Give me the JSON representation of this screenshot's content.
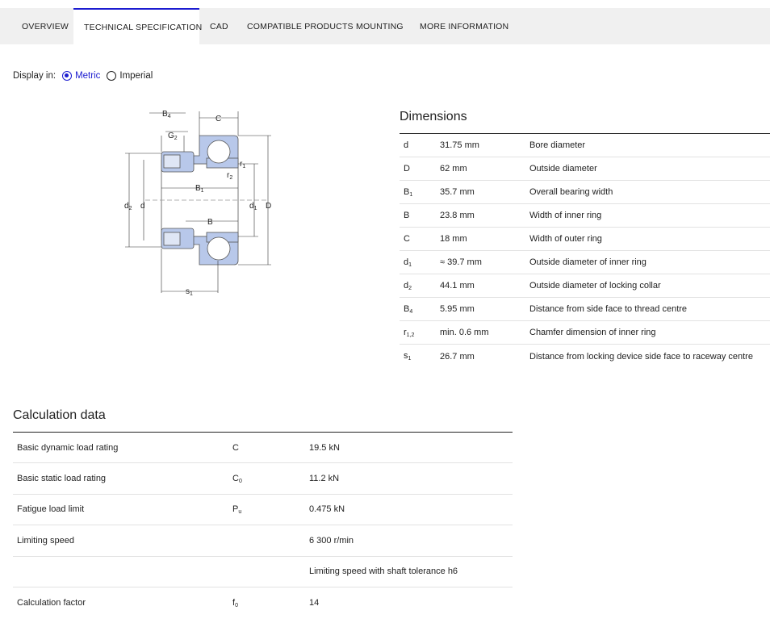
{
  "tabs": [
    {
      "label": "OVERVIEW"
    },
    {
      "label": "TECHNICAL SPECIFICATION"
    },
    {
      "label": "CAD"
    },
    {
      "label": "COMPATIBLE PRODUCTS"
    },
    {
      "label": "MOUNTING"
    },
    {
      "label": "MORE INFORMATION"
    }
  ],
  "display": {
    "label": "Display in:",
    "metric": "Metric",
    "imperial": "Imperial",
    "selected": "Metric"
  },
  "drawing_labels": {
    "B4": "B",
    "B4_sub": "4",
    "G2": "G",
    "G2_sub": "2",
    "C": "C",
    "r1": "r",
    "r1_sub": "1",
    "r2": "r",
    "r2_sub": "2",
    "B1": "B",
    "B1_sub": "1",
    "B": "B",
    "d2": "d",
    "d2_sub": "2",
    "d": "d",
    "d1": "d",
    "d1_sub": "1",
    "D": "D",
    "s1": "s",
    "s1_sub": "1"
  },
  "dimensions": {
    "title": "Dimensions",
    "rows": [
      {
        "sym": "d",
        "sub": "",
        "value": "31.75 mm",
        "desc": "Bore diameter"
      },
      {
        "sym": "D",
        "sub": "",
        "value": "62 mm",
        "desc": "Outside diameter"
      },
      {
        "sym": "B",
        "sub": "1",
        "value": "35.7 mm",
        "desc": "Overall bearing width"
      },
      {
        "sym": "B",
        "sub": "",
        "value": "23.8 mm",
        "desc": "Width of inner ring"
      },
      {
        "sym": "C",
        "sub": "",
        "value": "18 mm",
        "desc": "Width of outer ring"
      },
      {
        "sym": "d",
        "sub": "1",
        "value": "≈ 39.7 mm",
        "desc": "Outside diameter of inner ring"
      },
      {
        "sym": "d",
        "sub": "2",
        "value": "44.1 mm",
        "desc": "Outside diameter of locking collar"
      },
      {
        "sym": "B",
        "sub": "4",
        "value": "5.95 mm",
        "desc": "Distance from side face to thread centre"
      },
      {
        "sym": "r",
        "sub": "1,2",
        "value": "min. 0.6 mm",
        "desc": "Chamfer dimension of inner ring"
      },
      {
        "sym": "s",
        "sub": "1",
        "value": "26.7 mm",
        "desc": "Distance from locking device side face to raceway centre"
      }
    ]
  },
  "calculation": {
    "title": "Calculation data",
    "rows": [
      {
        "name": "Basic dynamic load rating",
        "sym": "C",
        "sub": "",
        "value": "19.5 kN"
      },
      {
        "name": "Basic static load rating",
        "sym": "C",
        "sub": "0",
        "value": "11.2 kN"
      },
      {
        "name": "Fatigue load limit",
        "sym": "P",
        "sub": "u",
        "value": "0.475 kN"
      },
      {
        "name": "Limiting speed",
        "sym": "",
        "sub": "",
        "value": "6 300 r/min"
      },
      {
        "name": "",
        "sym": "",
        "sub": "",
        "value": "Limiting speed with shaft tolerance h6"
      },
      {
        "name": "Calculation factor",
        "sym": "f",
        "sub": "0",
        "value": "14"
      }
    ]
  },
  "colors": {
    "accent": "#1c1cd0",
    "bearing_fill": "#b8c8ea"
  }
}
